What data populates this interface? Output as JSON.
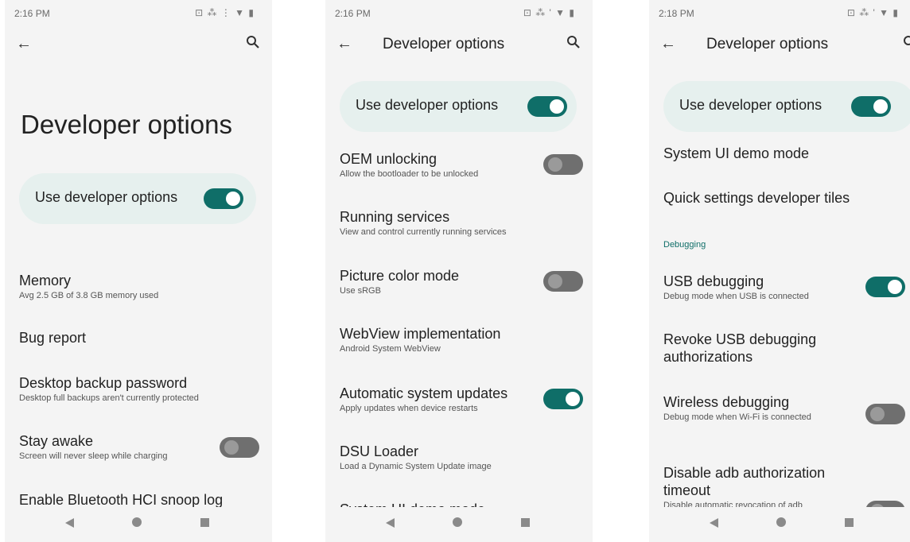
{
  "screens": [
    {
      "status_time": "2:16 PM",
      "status_icons": "⊡ ⁂ ⋮ ▼ ▮",
      "big_title": "Developer options",
      "main_switch": {
        "label": "Use developer options",
        "on": true
      },
      "items": [
        {
          "title": "Memory",
          "subtitle": "Avg 2.5 GB of 3.8 GB memory used"
        },
        {
          "title": "Bug report"
        },
        {
          "title": "Desktop backup password",
          "subtitle": "Desktop full backups aren't currently protected"
        },
        {
          "title": "Stay awake",
          "subtitle": "Screen will never sleep while charging",
          "toggle": "off"
        },
        {
          "title": "Enable Bluetooth HCI snoop log"
        }
      ]
    },
    {
      "status_time": "2:16 PM",
      "status_icons": "⊡ ⁂ ' ▼ ▮",
      "title": "Developer options",
      "main_switch": {
        "label": "Use developer options",
        "on": true
      },
      "items": [
        {
          "title": "OEM unlocking",
          "subtitle": "Allow the bootloader to be unlocked",
          "toggle": "off"
        },
        {
          "title": "Running services",
          "subtitle": "View and control currently running services"
        },
        {
          "title": "Picture color mode",
          "subtitle": "Use sRGB",
          "toggle": "off"
        },
        {
          "title": "WebView implementation",
          "subtitle": "Android System WebView"
        },
        {
          "title": "Automatic system updates",
          "subtitle": "Apply updates when device restarts",
          "toggle": "on"
        },
        {
          "title": "DSU Loader",
          "subtitle": "Load a Dynamic System Update image"
        },
        {
          "title": "System UI demo mode"
        }
      ]
    },
    {
      "status_time": "2:18 PM",
      "status_icons": "⊡ ⁂ ' ▼ ▮",
      "title": "Developer options",
      "main_switch": {
        "label": "Use developer options",
        "on": true
      },
      "items": [
        {
          "title": "System UI demo mode"
        },
        {
          "title": "Quick settings developer tiles"
        },
        {
          "title": "USB debugging",
          "subtitle": "Debug mode when USB is connected",
          "toggle": "on"
        },
        {
          "title": "Revoke USB debugging authorizations"
        },
        {
          "title": "Wireless debugging",
          "subtitle": "Debug mode when Wi-Fi is connected",
          "toggle": "off"
        },
        {
          "title": "Disable adb authorization timeout",
          "subtitle": "Disable automatic revocation of adb",
          "toggle": "off"
        }
      ],
      "category": "Debugging"
    }
  ],
  "colors": {
    "accent": "#0f6e68",
    "switch_bg": "#e6f0ee",
    "toggle_off": "#6f6f6f"
  },
  "icons": [
    "back-arrow-icon",
    "search-icon",
    "nav-back-icon",
    "nav-home-icon",
    "nav-recents-icon"
  ]
}
